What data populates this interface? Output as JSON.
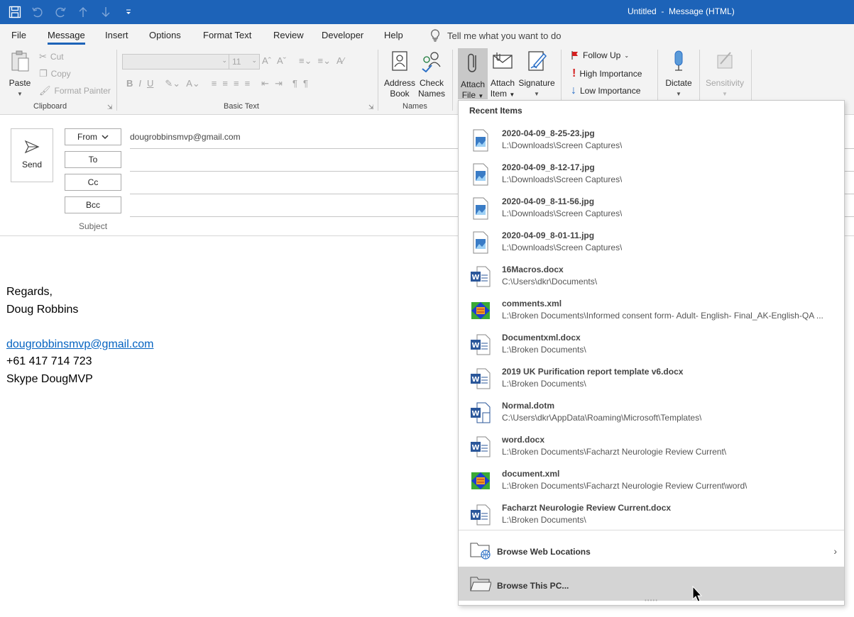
{
  "window": {
    "title": "Untitled  -  Message (HTML)"
  },
  "tabs": [
    "File",
    "Message",
    "Insert",
    "Options",
    "Format Text",
    "Review",
    "Developer",
    "Help"
  ],
  "tell_me": "Tell me what you want to do",
  "ribbon": {
    "paste": "Paste",
    "cut": "Cut",
    "copy": "Copy",
    "format_painter": "Format Painter",
    "clipboard_label": "Clipboard",
    "font_size": "11",
    "basic_text_label": "Basic Text",
    "address_book_1": "Address",
    "address_book_2": "Book",
    "check_names_1": "Check",
    "check_names_2": "Names",
    "names_label": "Names",
    "attach_file_1": "Attach",
    "attach_file_2": "File",
    "attach_item_1": "Attach",
    "attach_item_2": "Item",
    "signature": "Signature",
    "follow_up": "Follow Up",
    "high_importance": "High Importance",
    "low_importance": "Low Importance",
    "dictate": "Dictate",
    "sensitivity": "Sensitivity"
  },
  "compose": {
    "send": "Send",
    "from_label": "From",
    "from_value": "dougrobbinsmvp@gmail.com",
    "to_label": "To",
    "cc_label": "Cc",
    "bcc_label": "Bcc",
    "subject_label": "Subject"
  },
  "body": {
    "line1": "Regards,",
    "line2": "Doug Robbins",
    "email": "dougrobbinsmvp@gmail.com",
    "phone": "+61 417 714 723",
    "skype": "Skype DougMVP"
  },
  "attach_menu": {
    "header": "Recent Items",
    "items": [
      {
        "name": "2020-04-09_8-25-23.jpg",
        "path": "L:\\Downloads\\Screen Captures\\",
        "icon": "image-file-icon"
      },
      {
        "name": "2020-04-09_8-12-17.jpg",
        "path": "L:\\Downloads\\Screen Captures\\",
        "icon": "image-file-icon"
      },
      {
        "name": "2020-04-09_8-11-56.jpg",
        "path": "L:\\Downloads\\Screen Captures\\",
        "icon": "image-file-icon"
      },
      {
        "name": "2020-04-09_8-01-11.jpg",
        "path": "L:\\Downloads\\Screen Captures\\",
        "icon": "image-file-icon"
      },
      {
        "name": "16Macros.docx",
        "path": "C:\\Users\\dkr\\Documents\\",
        "icon": "word-doc-icon"
      },
      {
        "name": "comments.xml",
        "path": "L:\\Broken Documents\\Informed consent form- Adult- English- Final_AK-English-QA ...",
        "icon": "xml-file-icon"
      },
      {
        "name": "Documentxml.docx",
        "path": "L:\\Broken Documents\\",
        "icon": "word-doc-icon"
      },
      {
        "name": "2019 UK Purification report template v6.docx",
        "path": "L:\\Broken Documents\\",
        "icon": "word-doc-icon"
      },
      {
        "name": "Normal.dotm",
        "path": "C:\\Users\\dkr\\AppData\\Roaming\\Microsoft\\Templates\\",
        "icon": "word-template-icon"
      },
      {
        "name": "word.docx",
        "path": "L:\\Broken Documents\\Facharzt Neurologie Review Current\\",
        "icon": "word-doc-icon"
      },
      {
        "name": "document.xml",
        "path": "L:\\Broken Documents\\Facharzt Neurologie Review Current\\word\\",
        "icon": "xml-file-icon"
      },
      {
        "name": "Facharzt Neurologie Review Current.docx",
        "path": "L:\\Broken Documents\\",
        "icon": "word-doc-icon"
      }
    ],
    "browse_web": "Browse Web Locations",
    "browse_pc": "Browse This PC..."
  },
  "colors": {
    "accent": "#1d63b8",
    "word_blue": "#2b579a",
    "hover_gray": "#d4d4d4"
  }
}
